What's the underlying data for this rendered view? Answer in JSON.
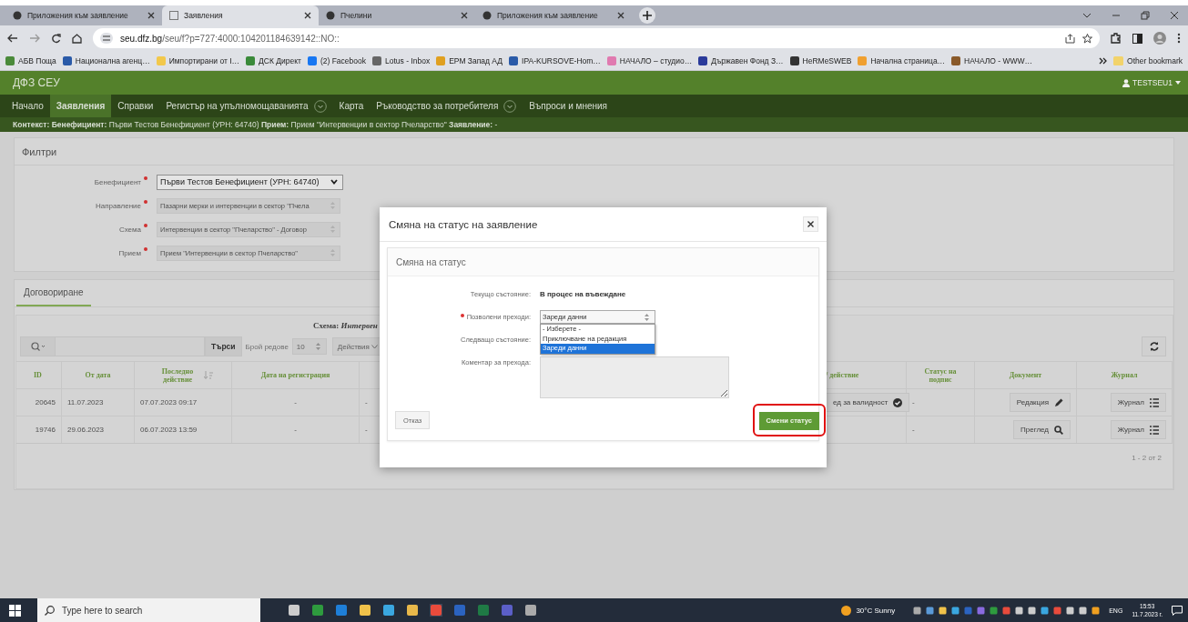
{
  "browser": {
    "tabs": [
      {
        "title": "Приложения към заявление",
        "selected": false
      },
      {
        "title": "Заявления",
        "selected": true
      },
      {
        "title": "Пчелини",
        "selected": false
      },
      {
        "title": "Приложения към заявление",
        "selected": false
      }
    ],
    "url_domain": "seu.dfz.bg",
    "url_path": "/seu/f?p=727:4000:104201184639142::NO::",
    "bookmarks": [
      {
        "label": "АБВ Поща",
        "color": "#4a8a3a"
      },
      {
        "label": "Национална агенц…",
        "color": "#2a5aa8"
      },
      {
        "label": "Импортирани от I…",
        "color": "#f2c84b"
      },
      {
        "label": "ДСК Директ",
        "color": "#3a8a3a"
      },
      {
        "label": "(2) Facebook",
        "color": "#1877f2"
      },
      {
        "label": "Lotus - Inbox",
        "color": "#666666"
      },
      {
        "label": "ЕРМ Запад АД",
        "color": "#e0a020"
      },
      {
        "label": "IPA-KURSOVE-Hom…",
        "color": "#2a5aa8"
      },
      {
        "label": "НАЧАЛО – студио…",
        "color": "#e07ab0"
      },
      {
        "label": "Държавен Фонд З…",
        "color": "#2a3a9a"
      },
      {
        "label": "HeRMeSWEB",
        "color": "#333333"
      },
      {
        "label": "Начална страница…",
        "color": "#f0a030"
      },
      {
        "label": "НАЧАЛО - WWW…",
        "color": "#8a5a2a"
      }
    ],
    "other_bookmarks": "Other bookmark"
  },
  "app": {
    "title": "ДФЗ СЕУ",
    "user": "TESTSEU1"
  },
  "nav": [
    {
      "label": "Начало",
      "selected": false,
      "has_menu": false
    },
    {
      "label": "Заявления",
      "selected": true,
      "has_menu": false
    },
    {
      "label": "Справки",
      "selected": false,
      "has_menu": false
    },
    {
      "label": "Регистър на упълномощаванията",
      "selected": false,
      "has_menu": true
    },
    {
      "label": "Карта",
      "selected": false,
      "has_menu": false
    },
    {
      "label": "Ръководство за потребителя",
      "selected": false,
      "has_menu": true
    },
    {
      "label": "Въпроси и мнения",
      "selected": false,
      "has_menu": false
    }
  ],
  "context": "**Контекст:** **Бенефициент:** Първи Тестов Бенефициент (УРН: 64740) **Прием:** Прием \"Интервенции в сектор Пчеларство\" **Заявление:** -",
  "filters": {
    "title": "Филтри",
    "fields": [
      {
        "label": "Бенефициент",
        "required": true,
        "value": "Първи Тестов Бенефициент (УРН: 64740)",
        "disabled": false
      },
      {
        "label": "Направление",
        "required": true,
        "value": "Пазарни мерки и интервенции в сектор \"Пчела",
        "disabled": true
      },
      {
        "label": "Схема",
        "required": true,
        "value": "Интервенции в сектор \"Пчеларство\" - Договор",
        "disabled": true
      },
      {
        "label": "Прием",
        "required": true,
        "value": "Прием \"Интервенции в сектор Пчеларство\"",
        "disabled": true
      }
    ]
  },
  "region_tabs": [
    {
      "label": "Договориране",
      "selected": true
    }
  ],
  "report": {
    "heading": "Схема: *Интервен*",
    "search_button": "Търси",
    "rows_label": "Брой редове",
    "rows_value": "10",
    "actions_button": "Действия",
    "columns": [
      {
        "label": "ID",
        "sorted": false
      },
      {
        "label": "От дата",
        "sorted": false
      },
      {
        "label": "Последно действие",
        "sorted": true
      },
      {
        "label": "Дата на регистрация",
        "sorted": false
      },
      {
        "sorted": false
      },
      {
        "label": "/ действие",
        "sorted": false
      },
      {
        "label": "Статус на подпис",
        "sorted": false
      },
      {
        "label": "Документ",
        "sorted": false
      },
      {
        "label": "Журнал",
        "sorted": false
      }
    ],
    "rows": [
      [
        {
          "kind": "text",
          "text": "20645"
        },
        {
          "kind": "text",
          "text": "11.07.2023"
        },
        {
          "kind": "text",
          "text": "07.07.2023 09:17"
        },
        {
          "kind": "text",
          "text": "-"
        },
        {
          "kind": "text",
          "text": "-"
        },
        {
          "kind": "validate_button",
          "text": "ед за валидност"
        },
        {
          "kind": "text",
          "text": "-"
        },
        {
          "kind": "edit_button",
          "text": "Редакция"
        },
        {
          "kind": "journal_button",
          "text": "Журнал"
        }
      ],
      [
        {
          "kind": "text",
          "text": "19746"
        },
        {
          "kind": "text",
          "text": "29.06.2023"
        },
        {
          "kind": "text",
          "text": "06.07.2023 13:59"
        },
        {
          "kind": "text",
          "text": "-"
        },
        {
          "kind": "text",
          "text": "-"
        },
        {
          "kind": "empty"
        },
        {
          "kind": "text",
          "text": "-"
        },
        {
          "kind": "view_button",
          "text": "Преглед"
        },
        {
          "kind": "journal_button",
          "text": "Журнал"
        }
      ]
    ],
    "pagination": "1 - 2 от 2"
  },
  "modal": {
    "title": "Смяна на статус на заявление",
    "section_title": "Смяна на статус",
    "current_state_label": "Текущо състояние:",
    "current_state": "В процес на въвеждане",
    "transition_label": "Позволени преходи:",
    "transition_required": true,
    "transition_value": "Зареди данни",
    "transition_options": [
      {
        "label": "- Изберете -",
        "selected": false
      },
      {
        "label": "Приключване на редакция",
        "selected": false
      },
      {
        "label": "Зареди данни",
        "selected": true
      }
    ],
    "next_state_label": "Следващо състояние:",
    "comment_label": "Коментар за прехода:",
    "cancel_button": "Отказ",
    "submit_button": "Смени статус",
    "submit_highlighted": true
  },
  "taskbar": {
    "search_placeholder": "Type here to search",
    "weather": "30°C Sunny",
    "language": "ENG",
    "time": "15:53",
    "date": "11.7.2023 г."
  }
}
